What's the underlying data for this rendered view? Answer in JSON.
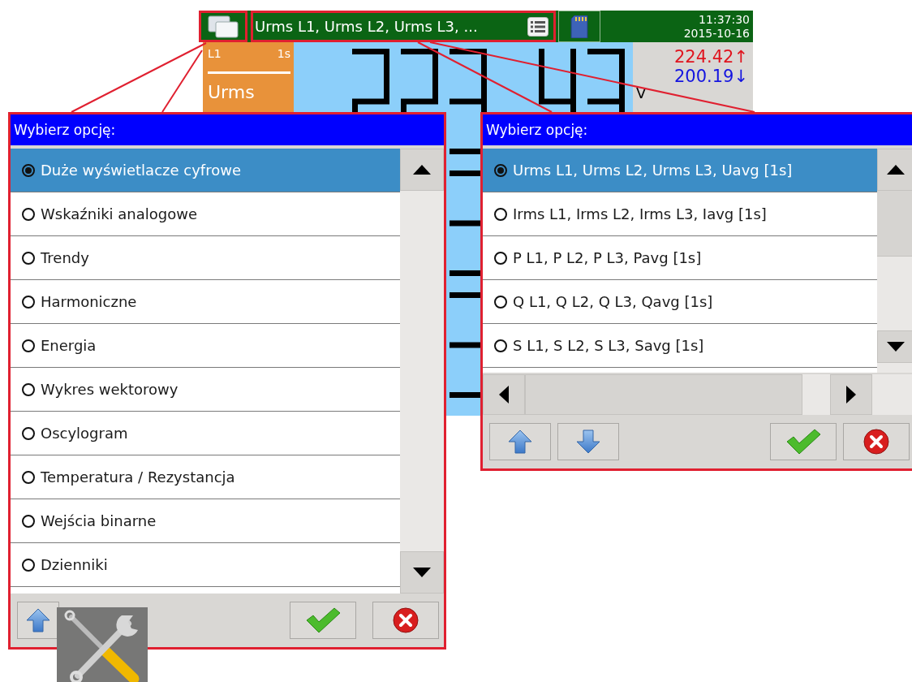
{
  "status_bar": {
    "title": "Urms L1, Urms L2, Urms L3, ...",
    "time": "11:37:30",
    "date": "2015-10-16"
  },
  "display": {
    "phase": "L1",
    "interval": "1s",
    "quantity": "Urms",
    "max": "224.42↑",
    "min": "200.19↓",
    "unit": "V"
  },
  "dialogs": [
    {
      "title": "Wybierz opcję:",
      "horizontal_scrollbar": false,
      "options": [
        {
          "label": "Duże wyświetlacze cyfrowe",
          "selected": true
        },
        {
          "label": "Wskaźniki analogowe",
          "selected": false
        },
        {
          "label": "Trendy",
          "selected": false
        },
        {
          "label": "Harmoniczne",
          "selected": false
        },
        {
          "label": "Energia",
          "selected": false
        },
        {
          "label": "Wykres wektorowy",
          "selected": false
        },
        {
          "label": "Oscylogram",
          "selected": false
        },
        {
          "label": "Temperatura / Rezystancja",
          "selected": false
        },
        {
          "label": "Wejścia binarne",
          "selected": false
        },
        {
          "label": "Dzienniki",
          "selected": false
        }
      ]
    },
    {
      "title": "Wybierz opcję:",
      "horizontal_scrollbar": true,
      "options": [
        {
          "label": "Urms L1, Urms L2, Urms L3, Uavg [1s]",
          "selected": true
        },
        {
          "label": "Irms L1, Irms L2, Irms L3, Iavg [1s]",
          "selected": false
        },
        {
          "label": "P L1, P L2, P L3, Pavg [1s]",
          "selected": false
        },
        {
          "label": "Q L1, Q L2, Q L3, Qavg [1s]",
          "selected": false
        },
        {
          "label": "S L1, S L2, S L3, Savg [1s]",
          "selected": false
        }
      ]
    }
  ]
}
